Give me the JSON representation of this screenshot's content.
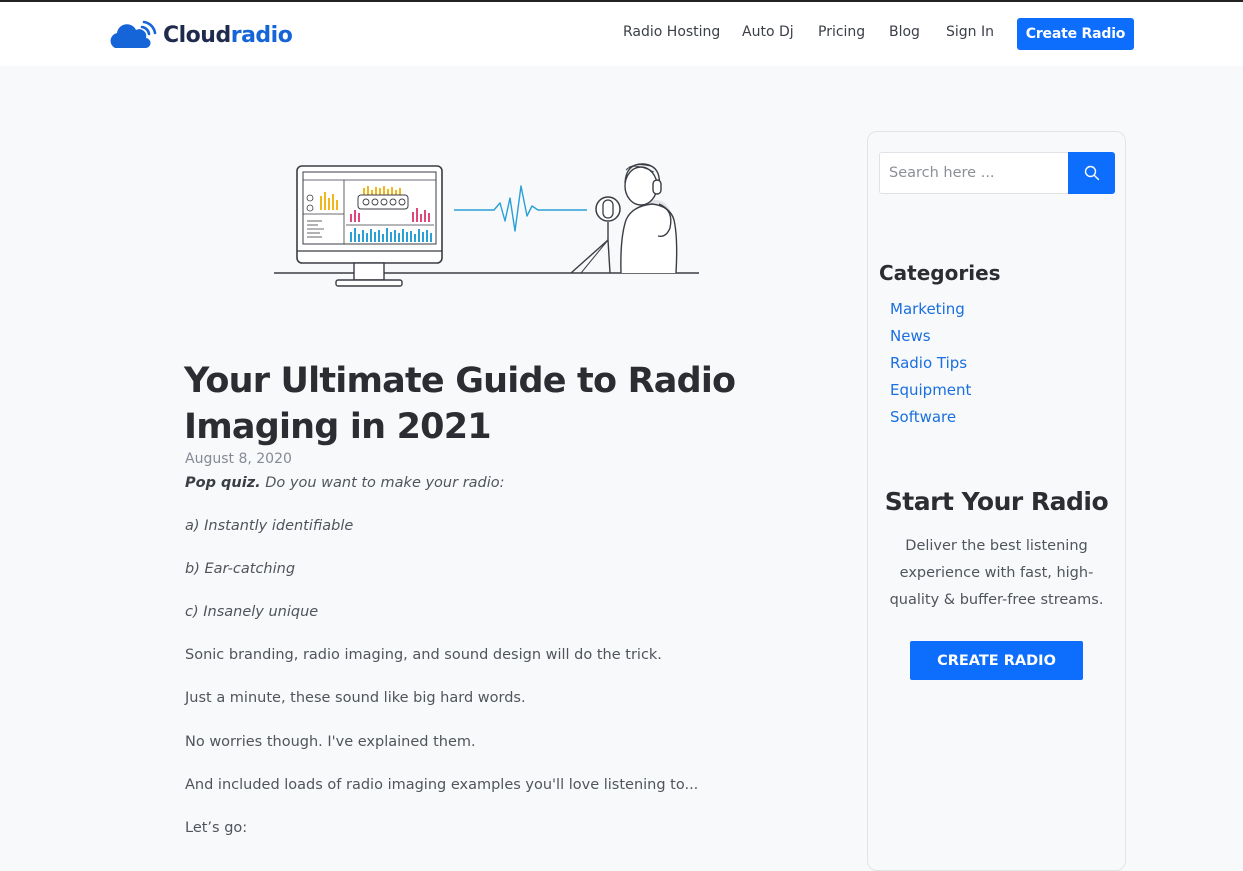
{
  "brand": {
    "name_part1": "Cloud",
    "name_part2": "radio"
  },
  "nav": {
    "links": [
      "Radio Hosting",
      "Auto Dj",
      "Pricing",
      "Blog",
      "Sign In"
    ],
    "cta": "Create Radio"
  },
  "article": {
    "title": "Your Ultimate Guide to Radio Imaging in 2021",
    "date": "August 8, 2020",
    "intro_bold": "Pop quiz.",
    "intro_rest": " Do you want to make your radio:",
    "option_a": "a) Instantly identifiable",
    "option_b": "b) Ear-catching",
    "option_c": "c) Insanely unique",
    "p1": "Sonic branding, radio imaging, and sound design will do the trick.",
    "p2": "Just a minute, these sound like big hard words.",
    "p3": "No worries though. I've explained them.",
    "p4": "And included loads of radio imaging examples you'll love listening to...",
    "p5": "Let’s go:"
  },
  "sidebar": {
    "search_placeholder": "Search here ...",
    "categories_title": "Categories",
    "categories": [
      "Marketing",
      "News",
      "Radio Tips",
      "Equipment",
      "Software"
    ],
    "cta_title": "Start Your Radio",
    "cta_text": "Deliver the best listening experience with fast, high-quality & buffer-free streams.",
    "cta_button": "CREATE RADIO"
  },
  "colors": {
    "accent": "#0d6efd",
    "link": "#1a6fe0",
    "heading": "#2b2d33"
  },
  "icons": {
    "search": "search-icon",
    "logo": "cloud-radio-icon"
  }
}
